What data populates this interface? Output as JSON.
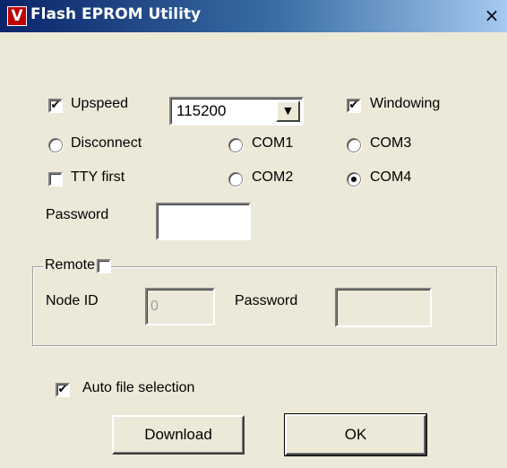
{
  "window": {
    "title": "Flash EPROM Utility",
    "icon": "V",
    "close_glyph": "×"
  },
  "upspeed": {
    "label": "Upspeed",
    "checked": true,
    "baud_value": "115200"
  },
  "windowing": {
    "label": "Windowing",
    "checked": true
  },
  "disconnect": {
    "label": "Disconnect",
    "selected": false
  },
  "tty_first": {
    "label": "TTY first",
    "checked": false
  },
  "ports": [
    {
      "label": "COM1",
      "selected": false
    },
    {
      "label": "COM2",
      "selected": false
    },
    {
      "label": "COM3",
      "selected": false
    },
    {
      "label": "COM4",
      "selected": true
    }
  ],
  "password": {
    "label": "Password",
    "value": ""
  },
  "remote": {
    "label": "Remote",
    "checked": false,
    "node_id_label": "Node ID",
    "node_id_value": "0",
    "password_label": "Password",
    "password_value": ""
  },
  "auto_file": {
    "label": "Auto file selection",
    "checked": true
  },
  "buttons": {
    "download": "Download",
    "ok": "OK"
  },
  "check_glyph": "✔"
}
